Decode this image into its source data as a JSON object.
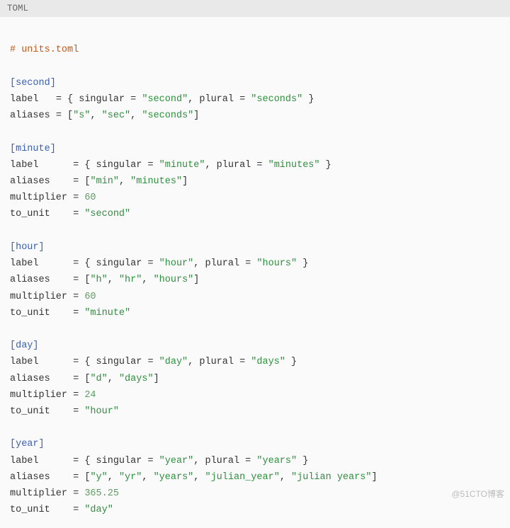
{
  "header": {
    "language": "TOML"
  },
  "comment": "# units.toml",
  "sections": {
    "second": {
      "name": "[second]",
      "label_key": "label",
      "label_eq": "   = ",
      "singular_k": "singular",
      "singular_v": "\"second\"",
      "plural_k": "plural",
      "plural_v": "\"seconds\"",
      "aliases_key": "aliases",
      "aliases_eq": " = ",
      "aliases_list": [
        "\"s\"",
        "\"sec\"",
        "\"seconds\""
      ]
    },
    "minute": {
      "name": "[minute]",
      "label_key": "label",
      "eq_wide": "      = ",
      "singular_k": "singular",
      "singular_v": "\"minute\"",
      "plural_k": "plural",
      "plural_v": "\"minutes\"",
      "aliases_key": "aliases",
      "aliases_eq": "    = ",
      "aliases_list": [
        "\"min\"",
        "\"minutes\""
      ],
      "multiplier_key": "multiplier",
      "multiplier_eq": " = ",
      "multiplier_v": "60",
      "to_unit_key": "to_unit",
      "to_unit_eq": "    = ",
      "to_unit_v": "\"second\""
    },
    "hour": {
      "name": "[hour]",
      "label_key": "label",
      "eq_wide": "      = ",
      "singular_k": "singular",
      "singular_v": "\"hour\"",
      "plural_k": "plural",
      "plural_v": "\"hours\"",
      "aliases_key": "aliases",
      "aliases_eq": "    = ",
      "aliases_list": [
        "\"h\"",
        "\"hr\"",
        "\"hours\""
      ],
      "multiplier_key": "multiplier",
      "multiplier_eq": " = ",
      "multiplier_v": "60",
      "to_unit_key": "to_unit",
      "to_unit_eq": "    = ",
      "to_unit_v": "\"minute\""
    },
    "day": {
      "name": "[day]",
      "label_key": "label",
      "eq_wide": "      = ",
      "singular_k": "singular",
      "singular_v": "\"day\"",
      "plural_k": "plural",
      "plural_v": "\"days\"",
      "aliases_key": "aliases",
      "aliases_eq": "    = ",
      "aliases_list": [
        "\"d\"",
        "\"days\""
      ],
      "multiplier_key": "multiplier",
      "multiplier_eq": " = ",
      "multiplier_v": "24",
      "to_unit_key": "to_unit",
      "to_unit_eq": "    = ",
      "to_unit_v": "\"hour\""
    },
    "year": {
      "name": "[year]",
      "label_key": "label",
      "eq_wide": "      = ",
      "singular_k": "singular",
      "singular_v": "\"year\"",
      "plural_k": "plural",
      "plural_v": "\"years\"",
      "aliases_key": "aliases",
      "aliases_eq": "    = ",
      "aliases_list": [
        "\"y\"",
        "\"yr\"",
        "\"years\"",
        "\"julian_year\"",
        "\"julian years\""
      ],
      "multiplier_key": "multiplier",
      "multiplier_eq": " = ",
      "multiplier_v": "365.25",
      "to_unit_key": "to_unit",
      "to_unit_eq": "    = ",
      "to_unit_v": "\"day\""
    }
  },
  "watermark": "@51CTO博客"
}
